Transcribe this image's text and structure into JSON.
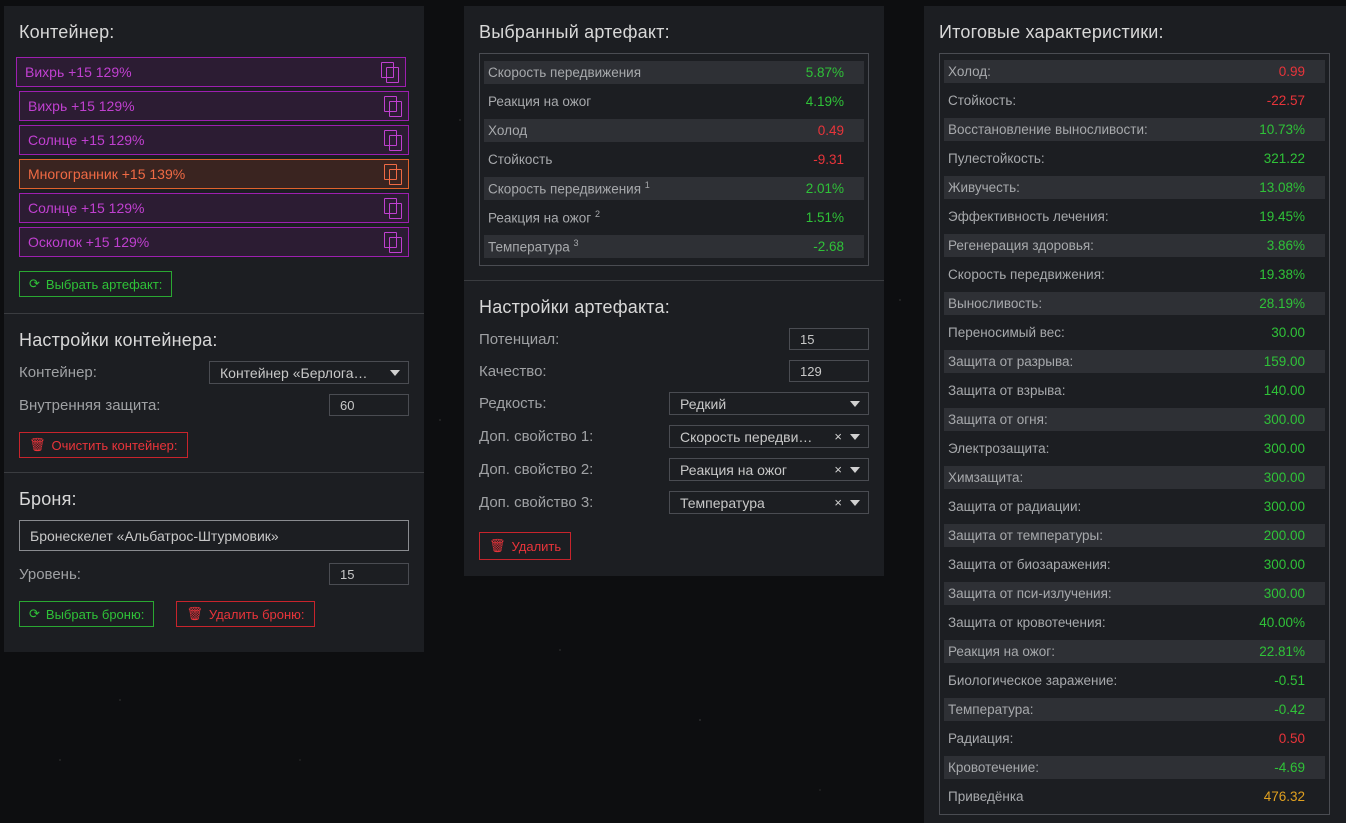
{
  "container_panel": {
    "title": "Контейнер:",
    "slots": [
      {
        "label": "Вихрь +15 129%",
        "color": "purple"
      },
      {
        "label": "Вихрь +15 129%",
        "color": "purple"
      },
      {
        "label": "Солнце +15 129%",
        "color": "purple"
      },
      {
        "label": "Многогранник +15 139%",
        "color": "orange"
      },
      {
        "label": "Солнце +15 129%",
        "color": "purple"
      },
      {
        "label": "Осколок +15 129%",
        "color": "purple"
      }
    ],
    "select_artifact_label": "Выбрать артефакт:",
    "settings_title": "Настройки контейнера:",
    "container_label": "Контейнер:",
    "container_value": "Контейнер «Берлога…",
    "protection_label": "Внутренняя защита:",
    "protection_value": "60",
    "clear_label": "Очистить контейнер:",
    "armor_title": "Броня:",
    "armor_value": "Бронескелет «Альбатрос-Штурмовик»",
    "level_label": "Уровень:",
    "level_value": "15",
    "select_armor_label": "Выбрать броню:",
    "delete_armor_label": "Удалить броню:"
  },
  "artifact_panel": {
    "title": "Выбранный артефакт:",
    "stats": [
      {
        "name": "Скорость передвижения",
        "sup": "",
        "value": "5.87%",
        "tone": "pos"
      },
      {
        "name": "Реакция на ожог",
        "sup": "",
        "value": "4.19%",
        "tone": "pos"
      },
      {
        "name": "Холод",
        "sup": "",
        "value": "0.49",
        "tone": "neg"
      },
      {
        "name": "Стойкость",
        "sup": "",
        "value": "-9.31",
        "tone": "neg"
      },
      {
        "name": "Скорость передвижения",
        "sup": "1",
        "value": "2.01%",
        "tone": "pos"
      },
      {
        "name": "Реакция на ожог",
        "sup": "2",
        "value": "1.51%",
        "tone": "pos"
      },
      {
        "name": "Температура",
        "sup": "3",
        "value": "-2.68",
        "tone": "pos"
      }
    ],
    "settings_title": "Настройки артефакта:",
    "potential_label": "Потенциал:",
    "potential_value": "15",
    "quality_label": "Качество:",
    "quality_value": "129",
    "rarity_label": "Редкость:",
    "rarity_value": "Редкий",
    "extra1_label": "Доп. свойство 1:",
    "extra1_value": "Скорость передви…",
    "extra2_label": "Доп. свойство 2:",
    "extra2_value": "Реакция на ожог",
    "extra3_label": "Доп. свойство 3:",
    "extra3_value": "Температура",
    "clear_x": "×",
    "delete_label": "Удалить"
  },
  "totals_panel": {
    "title": "Итоговые характеристики:",
    "stats": [
      {
        "name": "Холод:",
        "value": "0.99",
        "tone": "neg"
      },
      {
        "name": "Стойкость:",
        "value": "-22.57",
        "tone": "neg"
      },
      {
        "name": "Восстановление выносливости:",
        "value": "10.73%",
        "tone": "pos"
      },
      {
        "name": "Пулестойкость:",
        "value": "321.22",
        "tone": "pos"
      },
      {
        "name": "Живучесть:",
        "value": "13.08%",
        "tone": "pos"
      },
      {
        "name": "Эффективность лечения:",
        "value": "19.45%",
        "tone": "pos"
      },
      {
        "name": "Регенерация здоровья:",
        "value": "3.86%",
        "tone": "pos"
      },
      {
        "name": "Скорость передвижения:",
        "value": "19.38%",
        "tone": "pos"
      },
      {
        "name": "Выносливость:",
        "value": "28.19%",
        "tone": "pos"
      },
      {
        "name": "Переносимый вес:",
        "value": "30.00",
        "tone": "pos"
      },
      {
        "name": "Защита от разрыва:",
        "value": "159.00",
        "tone": "pos"
      },
      {
        "name": "Защита от взрыва:",
        "value": "140.00",
        "tone": "pos"
      },
      {
        "name": "Защита от огня:",
        "value": "300.00",
        "tone": "pos"
      },
      {
        "name": "Электрозащита:",
        "value": "300.00",
        "tone": "pos"
      },
      {
        "name": "Химзащита:",
        "value": "300.00",
        "tone": "pos"
      },
      {
        "name": "Защита от радиации:",
        "value": "300.00",
        "tone": "pos"
      },
      {
        "name": "Защита от температуры:",
        "value": "200.00",
        "tone": "pos"
      },
      {
        "name": "Защита от биозаражения:",
        "value": "300.00",
        "tone": "pos"
      },
      {
        "name": "Защита от пси-излучения:",
        "value": "300.00",
        "tone": "pos"
      },
      {
        "name": "Защита от кровотечения:",
        "value": "40.00%",
        "tone": "pos"
      },
      {
        "name": "Реакция на ожог:",
        "value": "22.81%",
        "tone": "pos"
      },
      {
        "name": "Биологическое заражение:",
        "value": "-0.51",
        "tone": "pos"
      },
      {
        "name": "Температура:",
        "value": "-0.42",
        "tone": "pos"
      },
      {
        "name": "Радиация:",
        "value": "0.50",
        "tone": "neg"
      },
      {
        "name": "Кровотечение:",
        "value": "-4.69",
        "tone": "pos"
      },
      {
        "name": "Приведёнка",
        "value": "476.32",
        "tone": "gold"
      }
    ]
  },
  "icons": {
    "copy": "copy-icon",
    "refresh": "refresh-icon",
    "trash": "trash-icon",
    "caret": "chevron-down-icon",
    "clear": "close-icon"
  },
  "colors": {
    "purple": "#c040d0",
    "orange": "#f06a44",
    "green": "#2fc238",
    "red": "#e8343a",
    "gold": "#e0a020"
  }
}
